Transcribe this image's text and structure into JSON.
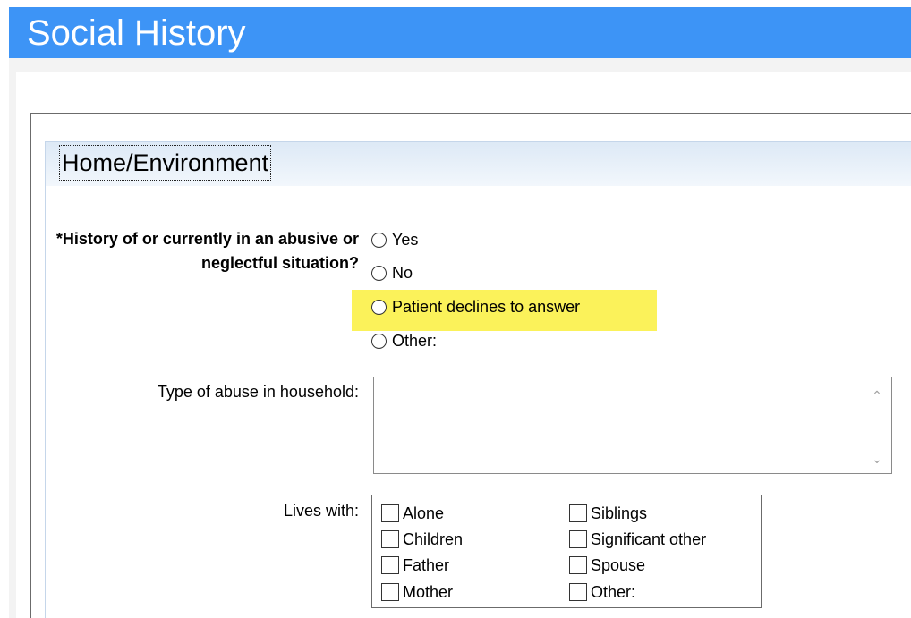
{
  "window": {
    "title": "Social History"
  },
  "section": {
    "title": "Home/Environment"
  },
  "abuse_question": {
    "label": "*History of or currently in an abusive or neglectful situation?",
    "options": [
      "Yes",
      "No",
      "Patient declines to answer",
      "Other:"
    ],
    "highlighted_option": "Patient declines to answer"
  },
  "abuse_type": {
    "label": "Type of abuse in household:",
    "value": ""
  },
  "lives_with": {
    "label": "Lives with:",
    "left_options": [
      "Alone",
      "Children",
      "Father",
      "Mother"
    ],
    "right_options": [
      "Siblings",
      "Significant other",
      "Spouse",
      "Other:"
    ]
  },
  "colors": {
    "title_bar": "#3d94f6",
    "highlight": "#fbf25a",
    "section_header": "#dde9f6"
  }
}
